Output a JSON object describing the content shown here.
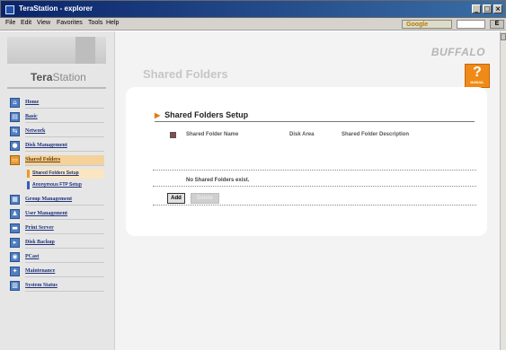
{
  "window": {
    "title": "TeraStation - explorer",
    "controls": [
      "_",
      "□",
      "×"
    ]
  },
  "menu": {
    "items": [
      "File",
      "Edit",
      "View",
      "Favorites",
      "Tools",
      "Help"
    ]
  },
  "toolbar": {
    "search_brand": "Google",
    "extra_button": "E"
  },
  "brand": {
    "logo_tera": "Tera",
    "logo_station": "Station",
    "buffalo": "BUFFALO"
  },
  "header": {
    "page_title": "Shared Folders",
    "help_symbol": "?",
    "help_label": "MANUAL",
    "help_color": "#f08a16"
  },
  "sidebar": {
    "items": [
      {
        "label": "Home",
        "icon": "home-icon"
      },
      {
        "label": "Basic",
        "icon": "basic-icon"
      },
      {
        "label": "Network",
        "icon": "network-icon"
      },
      {
        "label": "Disk Management",
        "icon": "disk-icon"
      },
      {
        "label": "Shared Folders",
        "icon": "folder-icon",
        "active": true
      },
      {
        "label": "Group Management",
        "icon": "group-icon"
      },
      {
        "label": "User Management",
        "icon": "user-icon"
      },
      {
        "label": "Print Server",
        "icon": "printer-icon"
      },
      {
        "label": "Disk Backup",
        "icon": "backup-icon"
      },
      {
        "label": "PCast",
        "icon": "pcast-icon"
      },
      {
        "label": "Maintenance",
        "icon": "maintenance-icon"
      },
      {
        "label": "System Status",
        "icon": "status-icon"
      }
    ],
    "subitems": [
      {
        "label": "Shared Folders Setup",
        "active": true
      },
      {
        "label": "Anonymous FTP Setup"
      }
    ]
  },
  "main": {
    "section_title": "Shared Folders Setup",
    "columns": [
      "Shared Folder Name",
      "Disk Area",
      "Shared Folder Description"
    ],
    "empty_message": "No Shared Folders exist.",
    "add_button": "Add",
    "delete_button": "Delete"
  }
}
